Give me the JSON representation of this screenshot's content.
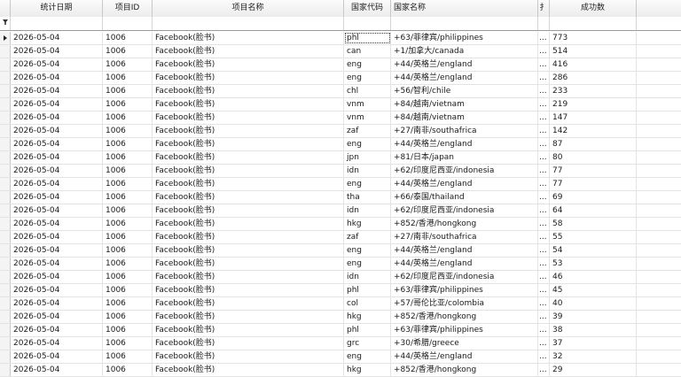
{
  "columns": [
    {
      "key": "date",
      "label": "统计日期"
    },
    {
      "key": "project_id",
      "label": "项目ID"
    },
    {
      "key": "project_name",
      "label": "项目名称"
    },
    {
      "key": "country_code",
      "label": "国家代码"
    },
    {
      "key": "country_name",
      "label": "国家名称"
    },
    {
      "key": "truncated",
      "label": "扌"
    },
    {
      "key": "success_count",
      "label": "成功数"
    }
  ],
  "truncated_cell": "...",
  "rows": [
    [
      "2026-05-04",
      "1006",
      "Facebook(脸书)",
      "phl",
      "+63/菲律宾/philippines",
      "773"
    ],
    [
      "2026-05-04",
      "1006",
      "Facebook(脸书)",
      "can",
      "+1/加拿大/canada",
      "514"
    ],
    [
      "2026-05-04",
      "1006",
      "Facebook(脸书)",
      "eng",
      "+44/英格兰/england",
      "416"
    ],
    [
      "2026-05-04",
      "1006",
      "Facebook(脸书)",
      "eng",
      "+44/英格兰/england",
      "286"
    ],
    [
      "2026-05-04",
      "1006",
      "Facebook(脸书)",
      "chl",
      "+56/智利/chile",
      "233"
    ],
    [
      "2026-05-04",
      "1006",
      "Facebook(脸书)",
      "vnm",
      "+84/越南/vietnam",
      "219"
    ],
    [
      "2026-05-04",
      "1006",
      "Facebook(脸书)",
      "vnm",
      "+84/越南/vietnam",
      "147"
    ],
    [
      "2026-05-04",
      "1006",
      "Facebook(脸书)",
      "zaf",
      "+27/南非/southafrica",
      "142"
    ],
    [
      "2026-05-04",
      "1006",
      "Facebook(脸书)",
      "eng",
      "+44/英格兰/england",
      "87"
    ],
    [
      "2026-05-04",
      "1006",
      "Facebook(脸书)",
      "jpn",
      "+81/日本/japan",
      "80"
    ],
    [
      "2026-05-04",
      "1006",
      "Facebook(脸书)",
      "idn",
      "+62/印度尼西亚/indonesia",
      "77"
    ],
    [
      "2026-05-04",
      "1006",
      "Facebook(脸书)",
      "eng",
      "+44/英格兰/england",
      "77"
    ],
    [
      "2026-05-04",
      "1006",
      "Facebook(脸书)",
      "tha",
      "+66/泰国/thailand",
      "69"
    ],
    [
      "2026-05-04",
      "1006",
      "Facebook(脸书)",
      "idn",
      "+62/印度尼西亚/indonesia",
      "64"
    ],
    [
      "2026-05-04",
      "1006",
      "Facebook(脸书)",
      "hkg",
      "+852/香港/hongkong",
      "58"
    ],
    [
      "2026-05-04",
      "1006",
      "Facebook(脸书)",
      "zaf",
      "+27/南非/southafrica",
      "55"
    ],
    [
      "2026-05-04",
      "1006",
      "Facebook(脸书)",
      "eng",
      "+44/英格兰/england",
      "54"
    ],
    [
      "2026-05-04",
      "1006",
      "Facebook(脸书)",
      "eng",
      "+44/英格兰/england",
      "53"
    ],
    [
      "2026-05-04",
      "1006",
      "Facebook(脸书)",
      "idn",
      "+62/印度尼西亚/indonesia",
      "46"
    ],
    [
      "2026-05-04",
      "1006",
      "Facebook(脸书)",
      "phl",
      "+63/菲律宾/philippines",
      "45"
    ],
    [
      "2026-05-04",
      "1006",
      "Facebook(脸书)",
      "col",
      "+57/哥伦比亚/colombia",
      "40"
    ],
    [
      "2026-05-04",
      "1006",
      "Facebook(脸书)",
      "hkg",
      "+852/香港/hongkong",
      "39"
    ],
    [
      "2026-05-04",
      "1006",
      "Facebook(脸书)",
      "phl",
      "+63/菲律宾/philippines",
      "38"
    ],
    [
      "2026-05-04",
      "1006",
      "Facebook(脸书)",
      "grc",
      "+30/希腊/greece",
      "37"
    ],
    [
      "2026-05-04",
      "1006",
      "Facebook(脸书)",
      "eng",
      "+44/英格兰/england",
      "32"
    ],
    [
      "2026-05-04",
      "1006",
      "Facebook(脸书)",
      "hkg",
      "+852/香港/hongkong",
      "29"
    ]
  ],
  "icons": {
    "current_row": "row-pointer-icon",
    "filter": "filter-funnel-icon"
  },
  "colors": {
    "header_bg": "#efefef",
    "grid_line": "#e3e3e3",
    "focus": "#333333"
  }
}
